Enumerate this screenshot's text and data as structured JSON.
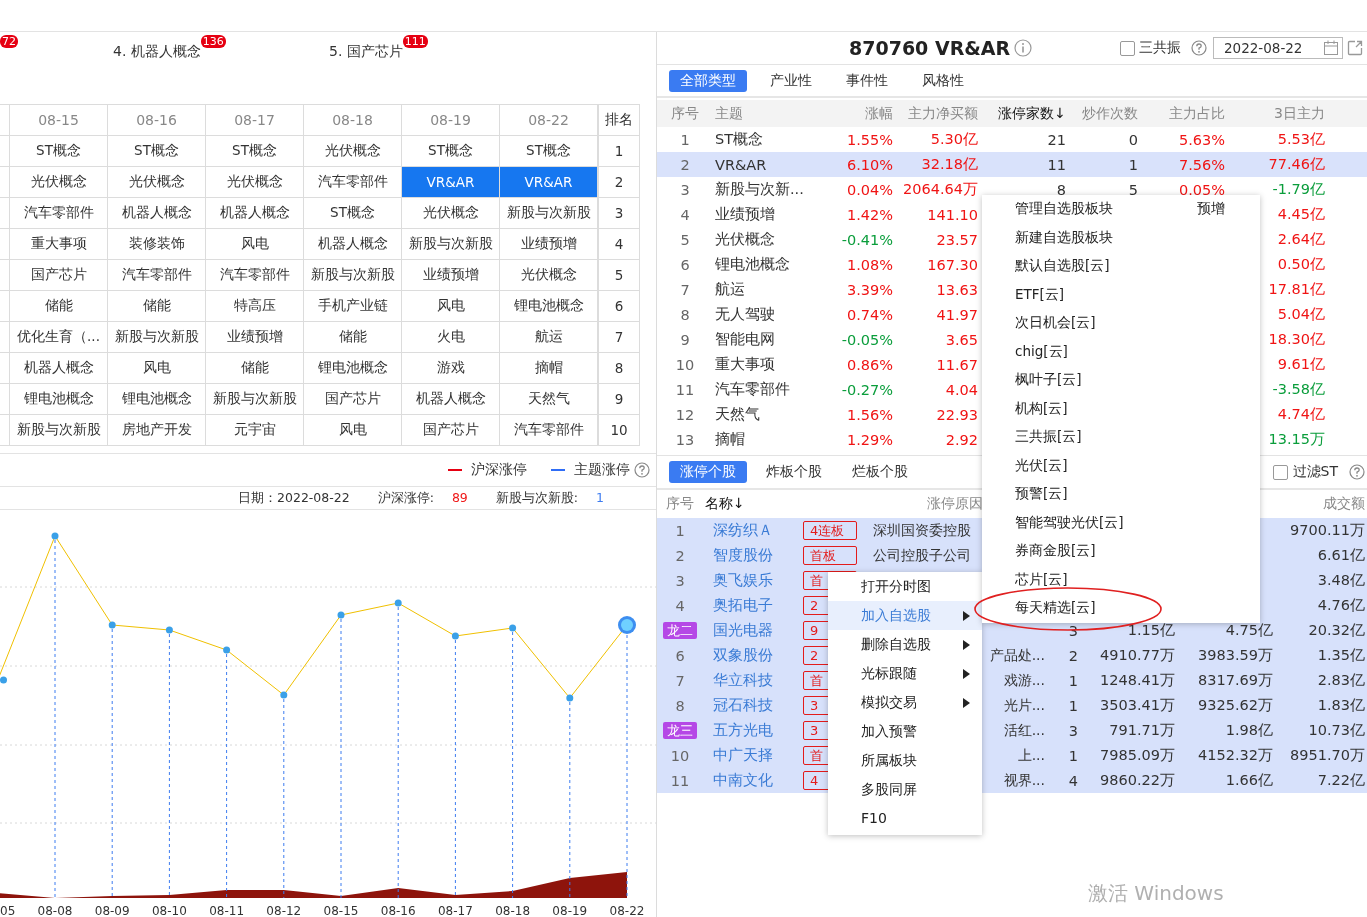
{
  "theme_strip": [
    {
      "badge": "72"
    },
    {
      "title": "4. 机器人概念",
      "badge": "136"
    },
    {
      "title": "5. 国产芯片",
      "badge": "111"
    }
  ],
  "date_table": {
    "columns": [
      "08-15",
      "08-16",
      "08-17",
      "08-18",
      "08-19",
      "08-22"
    ],
    "rank_header": "排名",
    "rows": [
      {
        "rank": "1",
        "cells": [
          {
            "text": "ST概念",
            "selected": false
          },
          {
            "text": "ST概念",
            "selected": false
          },
          {
            "text": "ST概念",
            "selected": false
          },
          {
            "text": "光伏概念",
            "selected": false
          },
          {
            "text": "ST概念",
            "selected": false
          },
          {
            "text": "ST概念",
            "selected": false
          }
        ]
      },
      {
        "rank": "2",
        "cells": [
          {
            "text": "光伏概念",
            "selected": false
          },
          {
            "text": "光伏概念",
            "selected": false
          },
          {
            "text": "光伏概念",
            "selected": false
          },
          {
            "text": "汽车零部件",
            "selected": false
          },
          {
            "text": "VR&AR",
            "selected": true
          },
          {
            "text": "VR&AR",
            "selected": true
          }
        ]
      },
      {
        "rank": "3",
        "cells": [
          {
            "text": "汽车零部件",
            "selected": false
          },
          {
            "text": "机器人概念",
            "selected": false
          },
          {
            "text": "机器人概念",
            "selected": false
          },
          {
            "text": "ST概念",
            "selected": false
          },
          {
            "text": "光伏概念",
            "selected": false
          },
          {
            "text": "新股与次新股",
            "selected": false
          }
        ]
      },
      {
        "rank": "4",
        "cells": [
          {
            "text": "重大事项",
            "selected": false
          },
          {
            "text": "装修装饰",
            "selected": false
          },
          {
            "text": "风电",
            "selected": false
          },
          {
            "text": "机器人概念",
            "selected": false
          },
          {
            "text": "新股与次新股",
            "selected": false
          },
          {
            "text": "业绩预增",
            "selected": false
          }
        ]
      },
      {
        "rank": "5",
        "cells": [
          {
            "text": "国产芯片",
            "selected": false
          },
          {
            "text": "汽车零部件",
            "selected": false
          },
          {
            "text": "汽车零部件",
            "selected": false
          },
          {
            "text": "新股与次新股",
            "selected": false
          },
          {
            "text": "业绩预增",
            "selected": false
          },
          {
            "text": "光伏概念",
            "selected": false
          }
        ]
      },
      {
        "rank": "6",
        "cells": [
          {
            "text": "储能",
            "selected": false
          },
          {
            "text": "储能",
            "selected": false
          },
          {
            "text": "特高压",
            "selected": false
          },
          {
            "text": "手机产业链",
            "selected": false
          },
          {
            "text": "风电",
            "selected": false
          },
          {
            "text": "锂电池概念",
            "selected": false
          }
        ]
      },
      {
        "rank": "7",
        "cells": [
          {
            "text": "优化生育（...",
            "selected": false
          },
          {
            "text": "新股与次新股",
            "selected": false
          },
          {
            "text": "业绩预增",
            "selected": false
          },
          {
            "text": "储能",
            "selected": false
          },
          {
            "text": "火电",
            "selected": false
          },
          {
            "text": "航运",
            "selected": false
          }
        ]
      },
      {
        "rank": "8",
        "cells": [
          {
            "text": "机器人概念",
            "selected": false
          },
          {
            "text": "风电",
            "selected": false
          },
          {
            "text": "储能",
            "selected": false
          },
          {
            "text": "锂电池概念",
            "selected": false
          },
          {
            "text": "游戏",
            "selected": false
          },
          {
            "text": "摘帽",
            "selected": false
          }
        ]
      },
      {
        "rank": "9",
        "cells": [
          {
            "text": "锂电池概念",
            "selected": false
          },
          {
            "text": "锂电池概念",
            "selected": false
          },
          {
            "text": "新股与次新股",
            "selected": false
          },
          {
            "text": "国产芯片",
            "selected": false
          },
          {
            "text": "机器人概念",
            "selected": false
          },
          {
            "text": "天然气",
            "selected": false
          }
        ]
      },
      {
        "rank": "10",
        "cells": [
          {
            "text": "新股与次新股",
            "selected": false
          },
          {
            "text": "房地产开发",
            "selected": false
          },
          {
            "text": "元宇宙",
            "selected": false
          },
          {
            "text": "风电",
            "selected": false
          },
          {
            "text": "国产芯片",
            "selected": false
          },
          {
            "text": "汽车零部件",
            "selected": false
          }
        ]
      }
    ]
  },
  "legend": [
    {
      "label": "沪深涨停",
      "color": "#e60012"
    },
    {
      "label": "主题涨停",
      "color": "#2f6df6"
    }
  ],
  "info": [
    {
      "label": "日期：2022-08-22"
    },
    {
      "label": "沪深涨停:",
      "value": "89",
      "color": "#f01818"
    },
    {
      "label": "新股与次新股:",
      "value": "1",
      "color": "#3d7cf0"
    }
  ],
  "trend_chart": {
    "x_labels": [
      "05",
      "08-08",
      "08-09",
      "08-10",
      "08-11",
      "08-12",
      "08-15",
      "08-16",
      "08-17",
      "08-18",
      "08-19",
      "08-22"
    ]
  },
  "theme_panel": {
    "title": "870760 VR&AR",
    "resonance": {
      "label": "三共振",
      "checked": false
    },
    "date": "2022-08-22",
    "tabs": [
      {
        "label": "全部类型",
        "selected": true
      },
      {
        "label": "产业性",
        "selected": false
      },
      {
        "label": "事件性",
        "selected": false
      },
      {
        "label": "风格性",
        "selected": false
      }
    ],
    "columns": [
      {
        "label": "序号",
        "sorted": false
      },
      {
        "label": "主题",
        "sorted": false
      },
      {
        "label": "涨幅",
        "sorted": false
      },
      {
        "label": "主力净买额",
        "sorted": false
      },
      {
        "label": "涨停家数↓",
        "sorted": true
      },
      {
        "label": "炒作次数",
        "sorted": false
      },
      {
        "label": "主力占比",
        "sorted": false
      },
      {
        "label": "3日主力",
        "sorted": false
      }
    ],
    "rows": [
      {
        "no": "1",
        "theme": "ST概念",
        "pct": "1.55%",
        "pct_up": true,
        "net": "5.30亿",
        "net_up": true,
        "count": "21",
        "times": "0",
        "ratio": "5.63%",
        "ratio_up": true,
        "main3": "5.53亿",
        "main3_up": true,
        "selected": false
      },
      {
        "no": "2",
        "theme": "VR&AR",
        "pct": "6.10%",
        "pct_up": true,
        "net": "32.18亿",
        "net_up": true,
        "count": "11",
        "times": "1",
        "ratio": "7.56%",
        "ratio_up": true,
        "main3": "77.46亿",
        "main3_up": true,
        "selected": true
      },
      {
        "no": "3",
        "theme": "新股与次新...",
        "pct": "0.04%",
        "pct_up": true,
        "net": "2064.64万",
        "net_up": true,
        "count": "8",
        "times": "5",
        "ratio": "0.05%",
        "ratio_up": true,
        "main3": "-1.79亿",
        "main3_up": false,
        "selected": false
      },
      {
        "no": "4",
        "theme": "业绩预增",
        "pct": "1.42%",
        "pct_up": true,
        "net": "141.10",
        "net_up": true,
        "main3": "4.45亿",
        "main3_up": true,
        "selected": false
      },
      {
        "no": "5",
        "theme": "光伏概念",
        "pct": "-0.41%",
        "pct_up": false,
        "net": "23.57",
        "net_up": true,
        "main3": "2.64亿",
        "main3_up": true,
        "selected": false
      },
      {
        "no": "6",
        "theme": "锂电池概念",
        "pct": "1.08%",
        "pct_up": true,
        "net": "167.30",
        "net_up": true,
        "main3": "0.50亿",
        "main3_up": true,
        "selected": false
      },
      {
        "no": "7",
        "theme": "航运",
        "pct": "3.39%",
        "pct_up": true,
        "net": "13.63",
        "net_up": true,
        "main3": "17.81亿",
        "main3_up": true,
        "selected": false
      },
      {
        "no": "8",
        "theme": "无人驾驶",
        "pct": "0.74%",
        "pct_up": true,
        "net": "41.97",
        "net_up": true,
        "main3": "5.04亿",
        "main3_up": true,
        "selected": false
      },
      {
        "no": "9",
        "theme": "智能电网",
        "pct": "-0.05%",
        "pct_up": false,
        "net": "3.65",
        "net_up": true,
        "main3": "18.30亿",
        "main3_up": true,
        "selected": false
      },
      {
        "no": "10",
        "theme": "重大事项",
        "pct": "0.86%",
        "pct_up": true,
        "net": "11.67",
        "net_up": true,
        "main3": "9.61亿",
        "main3_up": true,
        "selected": false
      },
      {
        "no": "11",
        "theme": "汽车零部件",
        "pct": "-0.27%",
        "pct_up": false,
        "net": "4.04",
        "net_up": true,
        "main3": "-3.58亿",
        "main3_up": false,
        "selected": false
      },
      {
        "no": "12",
        "theme": "天然气",
        "pct": "1.56%",
        "pct_up": true,
        "net": "22.93",
        "net_up": true,
        "main3": "4.74亿",
        "main3_up": true,
        "selected": false
      },
      {
        "no": "13",
        "theme": "摘帽",
        "pct": "1.29%",
        "pct_up": true,
        "net": "2.92",
        "net_up": true,
        "main3": "13.15万",
        "main3_up": false,
        "selected": false
      }
    ]
  },
  "stock_panel": {
    "tabs": [
      {
        "label": "涨停个股",
        "selected": true
      },
      {
        "label": "炸板个股",
        "selected": false
      },
      {
        "label": "烂板个股",
        "selected": false
      }
    ],
    "filter_st": {
      "label": "过滤ST",
      "checked": false
    },
    "header": {
      "no": "序号",
      "name": {
        "label": "名称↓",
        "sorted": true
      },
      "reason": "涨停原因",
      "turnover": "成交额"
    },
    "rows": [
      {
        "no": "1",
        "name": "深纺织Ａ",
        "tag": "4连板",
        "reason": "深圳国资委控股",
        "turnover": "9700.11万"
      },
      {
        "no": "2",
        "name": "智度股份",
        "tag": "首板",
        "reason": "公司控股子公司",
        "turnover": "6.61亿"
      },
      {
        "no": "3",
        "name": "奥飞娱乐",
        "tag": "首",
        "turnover": "3.48亿"
      },
      {
        "no": "4",
        "name": "奥拓电子",
        "tag": "2",
        "turnover": "4.76亿"
      },
      {
        "dragon": "龙二",
        "name": "国光电器",
        "tag": "9",
        "column_5": "3",
        "column_6": "1.15亿",
        "column_7": "4.75亿",
        "turnover": "20.32亿"
      },
      {
        "no": "6",
        "name": "双象股份",
        "tag": "2",
        "reason_tail": "产品处...",
        "column_5": "2",
        "column_6": "4910.77万",
        "column_7": "3983.59万",
        "turnover": "1.35亿"
      },
      {
        "no": "7",
        "name": "华立科技",
        "tag": "首",
        "reason_tail": "戏游...",
        "column_5": "1",
        "column_6": "1248.41万",
        "column_7": "8317.69万",
        "turnover": "2.83亿"
      },
      {
        "no": "8",
        "name": "冠石科技",
        "tag": "3",
        "reason_tail": "光片...",
        "column_5": "1",
        "column_6": "3503.41万",
        "column_7": "9325.62万",
        "turnover": "1.83亿"
      },
      {
        "dragon": "龙三",
        "name": "五方光电",
        "tag": "3",
        "reason_tail": "活红...",
        "column_5": "3",
        "column_6": "791.71万",
        "column_7": "1.98亿",
        "turnover": "10.73亿"
      },
      {
        "no": "10",
        "name": "中广天择",
        "tag": "首",
        "reason_tail": "上...",
        "column_5": "1",
        "column_6": "7985.09万",
        "column_7": "4152.32万",
        "turnover": "8951.70万"
      },
      {
        "no": "11",
        "name": "中南文化",
        "tag": "4",
        "reason_tail": "视界...",
        "column_5": "4",
        "column_6": "9860.22万",
        "column_7": "1.66亿",
        "turnover": "7.22亿"
      }
    ]
  },
  "context_menu": {
    "items": [
      {
        "label": "打开分时图",
        "has_submenu": false,
        "selected": false
      },
      {
        "label": "加入自选股",
        "has_submenu": true,
        "selected": true
      },
      {
        "label": "删除自选股",
        "has_submenu": true,
        "selected": false
      },
      {
        "label": "光标跟随",
        "has_submenu": true,
        "selected": false
      },
      {
        "label": "模拟交易",
        "has_submenu": true,
        "selected": false
      },
      {
        "label": "加入预警",
        "has_submenu": false,
        "selected": false
      },
      {
        "label": "所属板块",
        "has_submenu": false,
        "selected": false
      },
      {
        "label": "多股同屏",
        "has_submenu": false,
        "selected": false
      },
      {
        "label": "F10",
        "has_submenu": false,
        "selected": false
      }
    ]
  },
  "submenu": {
    "items": [
      {
        "label": "管理自选股板块",
        "note": "预增",
        "circled": false
      },
      {
        "label": "新建自选股板块",
        "circled": false
      },
      {
        "label": "默认自选股[云]",
        "circled": false
      },
      {
        "label": "ETF[云]",
        "circled": false
      },
      {
        "label": "次日机会[云]",
        "circled": false
      },
      {
        "label": "chig[云]",
        "circled": false
      },
      {
        "label": "枫叶子[云]",
        "circled": false
      },
      {
        "label": "机构[云]",
        "circled": false
      },
      {
        "label": "三共振[云]",
        "circled": false
      },
      {
        "label": "光伏[云]",
        "circled": false
      },
      {
        "label": "预警[云]",
        "circled": false
      },
      {
        "label": "智能驾驶光伏[云]",
        "circled": false
      },
      {
        "label": "券商金股[云]",
        "circled": false
      },
      {
        "label": "芯片[云]",
        "circled": false
      },
      {
        "label": "每天精选[云]",
        "circled": true
      }
    ]
  },
  "os_overlay": {
    "title": "激活 Windows"
  }
}
